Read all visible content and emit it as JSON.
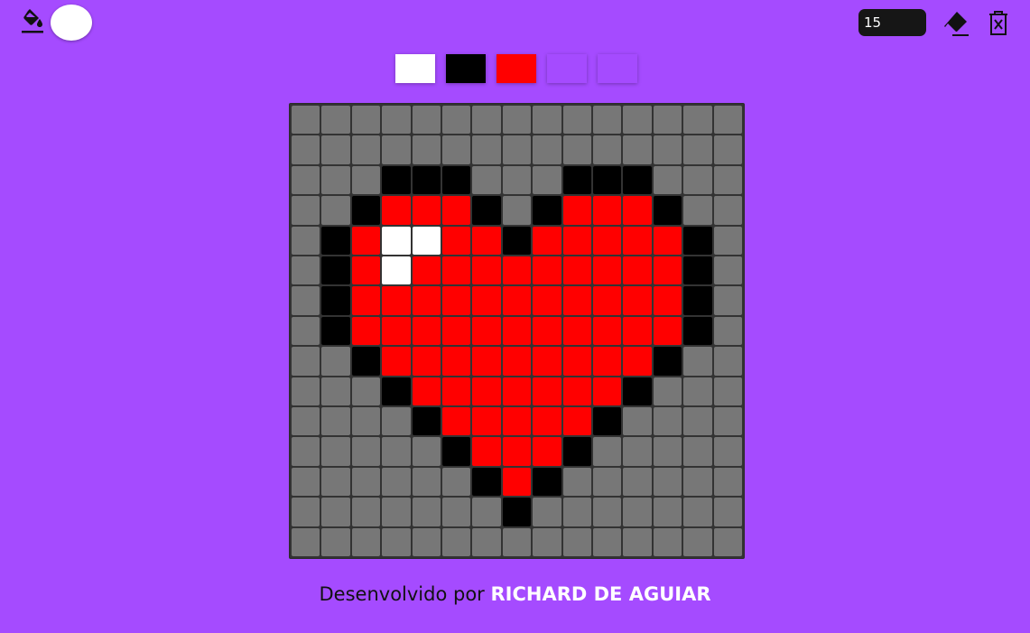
{
  "toolbar": {
    "fill_icon": "paint-bucket-icon",
    "current_color": "#ffffff",
    "pixel_size_value": "15",
    "eraser_icon": "eraser-icon",
    "clear_icon": "trash-x-icon"
  },
  "palette": [
    "#ffffff",
    "#000000",
    "#ff0000",
    "#a54bff",
    "#a54bff"
  ],
  "board": {
    "colors": {
      "G": "#777777",
      "B": "#000000",
      "R": "#ff0000",
      "W": "#ffffff"
    },
    "rows": [
      "GGGGGGGGGGGGGGG",
      "GGGGGGGGGGGGGGG",
      "GGGBBBGGGBBBGGG",
      "GGBRRRBGBRRRBGG",
      "GBRWWRRBRRRRRBG",
      "GBRWRRRRRRRRRBG",
      "GBRRRRRRRRRRRBG",
      "GBRRRRRRRRRRRBG",
      "GGBRRRRRRRRRBGG",
      "GGGBRRRRRRRBGGG",
      "GGGGBRRRRRBGGGG",
      "GGGGGBRRRBGGGGG",
      "GGGGGGBRBGGGGGG",
      "GGGGGGGBGGGGGGG",
      "GGGGGGGGGGGGGGG"
    ]
  },
  "footer": {
    "prefix": "Desenvolvido por ",
    "author": "RICHARD DE AGUIAR"
  }
}
